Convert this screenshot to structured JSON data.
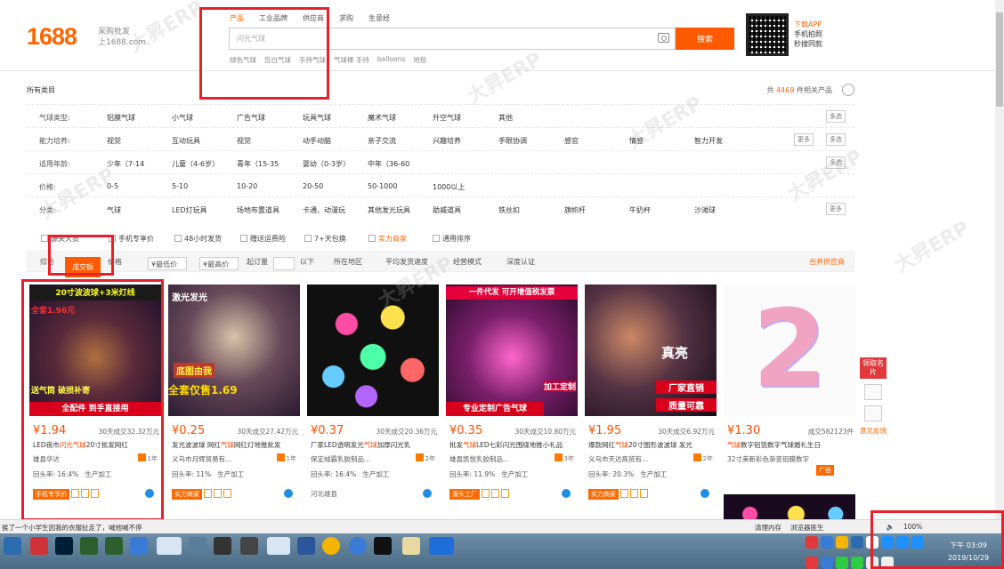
{
  "header": {
    "logo": "1688",
    "logo_slogan_1": "采购批发",
    "logo_slogan_2": "上1688.com",
    "search_tabs": [
      "产品",
      "工业品牌",
      "供应商",
      "求购",
      "生意经"
    ],
    "search_value": "闪光气球",
    "search_button": "搜索",
    "hot_words": [
      "绿色气球",
      "告白气球",
      "手持气球",
      "气球棒 手持",
      "balloons",
      "地毯"
    ],
    "app_promo": [
      "下载APP",
      "手机拍照",
      "秒搜同款"
    ]
  },
  "filter": {
    "breadcrumb": "所有类目",
    "total_prefix": "共",
    "total_count": "4469",
    "total_suffix": "件相关产品",
    "rows": [
      {
        "label": "气球类型:",
        "options": [
          "铝膜气球",
          "小气球",
          "广告气球",
          "玩具气球",
          "魔术气球",
          "升空气球",
          "其他"
        ],
        "more": "多选"
      },
      {
        "label": "能力培养:",
        "options": [
          "视觉",
          "互动玩具",
          "视觉",
          "动手动脑",
          "亲子交流",
          "兴趣培养",
          "手眼协调",
          "感官",
          "情感",
          "智力开发"
        ],
        "more": "多选",
        "more2": "更多"
      },
      {
        "label": "适用年龄:",
        "options": [
          "少年（7-14",
          "儿童（4-6岁）",
          "青年（15-35",
          "婴幼（0-3岁）",
          "中年（36-60"
        ],
        "more": "多选"
      },
      {
        "label": "价格:",
        "options": [
          "0-5",
          "5-10",
          "10-20",
          "20-50",
          "50-1000",
          "1000以上"
        ]
      },
      {
        "label": "分类:",
        "options": [
          "气球",
          "LED灯玩具",
          "场地布置道具",
          "卡通、动漫玩",
          "其他发光玩具",
          "助威道具",
          "铁丝扣",
          "旗帜杆",
          "牛奶杯",
          "沙滩球"
        ],
        "more": "更多"
      }
    ]
  },
  "services": [
    "源头大货",
    "手机专享价",
    "48小时发货",
    "赠送运费险",
    "7+天包换",
    "实力商家",
    "通用排序"
  ],
  "sortbar": {
    "items": [
      "综合",
      "成交额",
      "价格",
      "¥最低价",
      "¥最高价",
      "起订量",
      "以下",
      "所在地区",
      "平均发货速度",
      "经营模式",
      "深度认证"
    ],
    "right": "合并供应商"
  },
  "products": [
    {
      "img_text_1": "20寸波波球+3米灯线",
      "img_text_2": "全套1.96元",
      "img_text_3": "送气筒 破损补寄",
      "img_text_4": "全配件 到手直接用",
      "price": "¥1.94",
      "sold": "30天成交32.32万元",
      "title_pre": "LED夜市",
      "title_hl": "闪光气球",
      "title_post": "20寸批发网红",
      "shop": "雄县华达",
      "years": "1年",
      "rate": "回头率: 16.4%",
      "mode": "生产加工",
      "tag": "手机专享价"
    },
    {
      "img_text_1": "激光发光",
      "img_text_2": "全套仅售1.69",
      "img_text_3": "底图由我",
      "price": "¥0.25",
      "sold": "30天成交27.42万元",
      "title_pre": "发光波波球 网红",
      "title_hl": "气球",
      "title_post": "网红灯地推批发",
      "shop": "义乌市月辉贸易有...",
      "years": "1年",
      "rate": "回头率: 11%",
      "mode": "生产加工",
      "tag": "实力商家"
    },
    {
      "img_text_1": "",
      "price": "¥0.37",
      "sold": "30天成交20.36万元",
      "title_pre": "厂家LED透明发光",
      "title_hl": "气球",
      "title_post": "加厚闪光乳",
      "shop": "保定绒霸乳胶制品...",
      "years": "2年",
      "rate": "回头率: 16.4%",
      "mode": "生产加工",
      "loc": "河北雄县"
    },
    {
      "img_text_1": "一件代发 可开增值税发票",
      "img_text_2": "专业定制广告气球",
      "img_text_3": "加工定制",
      "price": "¥0.35",
      "sold": "30天成交10.80万元",
      "title_pre": "批发",
      "title_hl": "气球",
      "title_post": "LED七彩闪光围绕地推小礼品",
      "shop": "雄县凯悦乳胶制品...",
      "years": "3年",
      "rate": "回头率: 11.9%",
      "mode": "生产加工",
      "tag": "源头工厂"
    },
    {
      "img_text_1": "真亮",
      "img_text_2": "厂家直销",
      "img_text_3": "质量可靠",
      "price": "¥1.95",
      "sold": "30天成交6.92万元",
      "title_pre": "爆款网红",
      "title_hl": "气球",
      "title_post": "20寸图形波波球 发光",
      "shop": "义乌市天达高贸有...",
      "years": "2年",
      "rate": "回头率: 20.3%",
      "mode": "生产加工",
      "tag": "实力商家"
    },
    {
      "img_text_1": "2",
      "price": "¥1.30",
      "sold": "成交582123件",
      "title_pre": "气球",
      "title_hl": "数字铝箔数字",
      "title_post": "气球婚礼生日",
      "shop": "32寸美新彩色渐变铝膜数字",
      "years": "",
      "rate": "",
      "mode": "",
      "tag": "广告"
    }
  ],
  "sidebar": {
    "items": [
      "领取名片",
      "意见反馈"
    ]
  },
  "statusbar": {
    "text": "挨了一个小学生因我的衣服扯走了，喊他喊不停",
    "items": [
      "清理内存",
      "浏览器医生",
      "100%"
    ]
  },
  "taskbar": {
    "time": "下午 03:09",
    "date": "2019/10/29"
  },
  "colors": {
    "brand": "#ff6600",
    "price": "#ff5000",
    "highlight_box": "#e8202c"
  }
}
